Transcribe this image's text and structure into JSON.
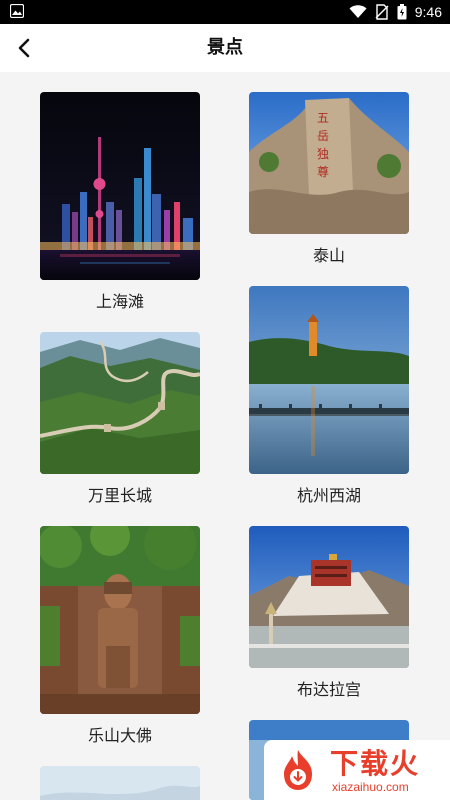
{
  "status_bar": {
    "time": "9:46",
    "icons": [
      "image-icon",
      "wifi-icon",
      "no-sim-icon",
      "battery-icon"
    ]
  },
  "header": {
    "title": "景点",
    "back_icon": "chevron-left-icon"
  },
  "attractions": [
    {
      "name": "上海滩"
    },
    {
      "name": "泰山"
    },
    {
      "name": "万里长城"
    },
    {
      "name": "杭州西湖"
    },
    {
      "name": "乐山大佛"
    },
    {
      "name": "布达拉宫"
    },
    {
      "name": ""
    },
    {
      "name": ""
    }
  ],
  "watermark": {
    "title": "下载火",
    "domain": "xiazaihuo.com"
  },
  "colors": {
    "status_bar_bg": "#000000",
    "app_bar_bg": "#ffffff",
    "page_bg": "#f4f4f4",
    "brand_red": "#e83f2c"
  }
}
